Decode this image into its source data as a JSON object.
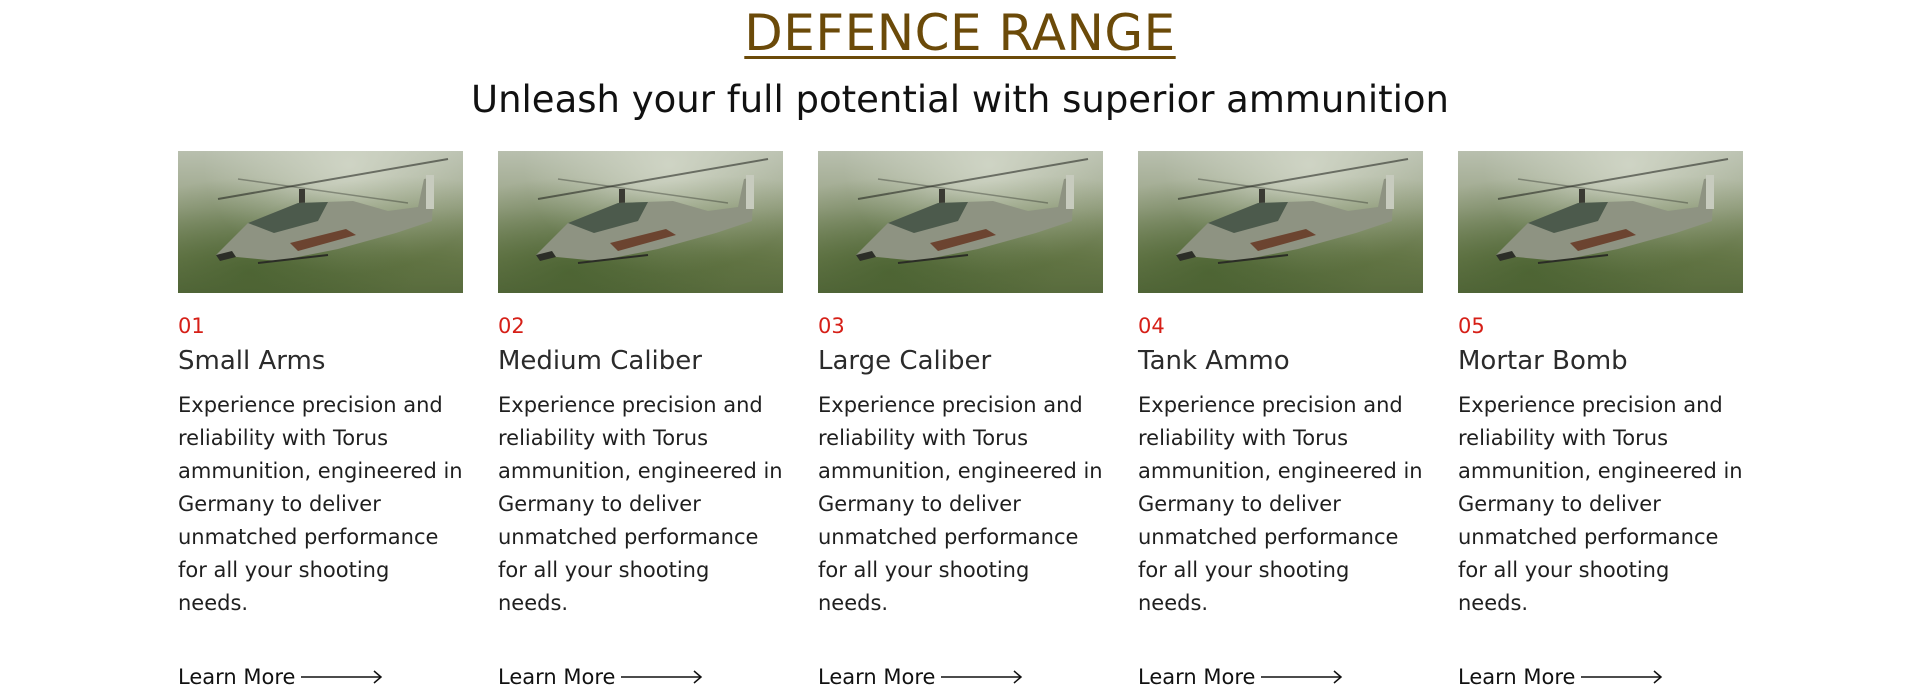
{
  "section": {
    "title": "DEFENCE RANGE",
    "subtitle": "Unleash your full potential with superior ammunition"
  },
  "colors": {
    "title": "#6b4a09",
    "number": "#d61f17",
    "text": "#1f1f1f"
  },
  "cards": [
    {
      "number": "01",
      "title": "Small Arms",
      "description": "Experience precision and reliability with Torus ammunition, engineered in Germany to deliver unmatched performance for all your shooting needs.",
      "link_label": "Learn More",
      "image": "helicopter-photo"
    },
    {
      "number": "02",
      "title": "Medium Caliber",
      "description": "Experience precision and reliability with Torus ammunition, engineered in Germany to deliver unmatched performance for all your shooting needs.",
      "link_label": "Learn More",
      "image": "helicopter-photo"
    },
    {
      "number": "03",
      "title": "Large Caliber",
      "description": "Experience precision and reliability with Torus ammunition, engineered in Germany to deliver unmatched performance for all your shooting needs.",
      "link_label": "Learn More",
      "image": "helicopter-photo"
    },
    {
      "number": "04",
      "title": "Tank Ammo",
      "description": "Experience precision and reliability with Torus ammunition, engineered in Germany to deliver unmatched performance for all your shooting needs.",
      "link_label": "Learn More",
      "image": "helicopter-photo"
    },
    {
      "number": "05",
      "title": "Mortar Bomb",
      "description": "Experience precision and reliability with Torus ammunition, engineered in Germany to deliver unmatched performance for all your shooting needs.",
      "link_label": "Learn More",
      "image": "helicopter-photo"
    }
  ]
}
